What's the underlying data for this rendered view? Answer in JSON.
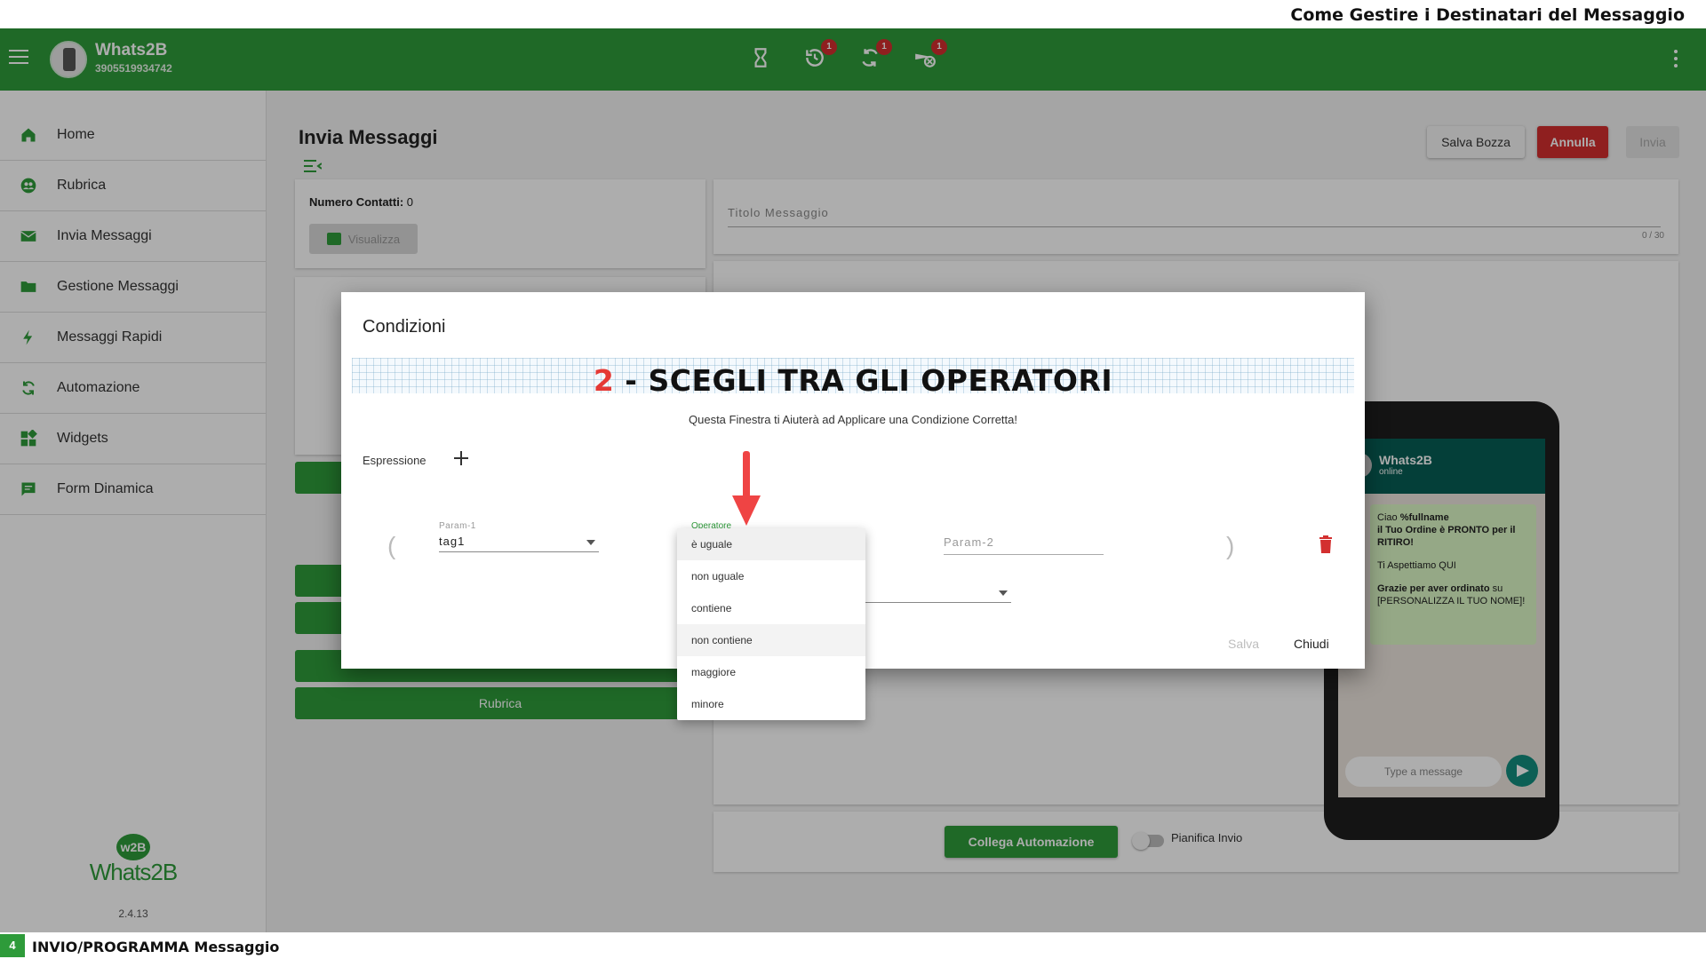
{
  "video": {
    "title": "Come Gestire i Destinatari del Messaggio"
  },
  "app": {
    "name": "Whats2B",
    "phone": "3905519934742"
  },
  "header_icons": [
    {
      "icon": "hourglass-icon",
      "badge": ""
    },
    {
      "icon": "history-icon",
      "badge": "1"
    },
    {
      "icon": "sync-icon",
      "badge": "1"
    },
    {
      "icon": "scheduled-off-icon",
      "badge": "1"
    }
  ],
  "sidebar": {
    "items": [
      {
        "label": "Home",
        "icon": "home-icon"
      },
      {
        "label": "Rubrica",
        "icon": "contacts-icon"
      },
      {
        "label": "Invia Messaggi",
        "icon": "mail-icon"
      },
      {
        "label": "Gestione Messaggi",
        "icon": "folder-icon"
      },
      {
        "label": "Messaggi Rapidi",
        "icon": "bolt-icon"
      },
      {
        "label": "Automazione",
        "icon": "refresh-icon"
      },
      {
        "label": "Widgets",
        "icon": "widgets-icon"
      },
      {
        "label": "Form Dinamica",
        "icon": "form-icon"
      }
    ],
    "logo_text": "Whats2B",
    "logo_badge": "w2B",
    "version": "2.4.13"
  },
  "main": {
    "page_title": "Invia Messaggi",
    "btn_draft": "Salva Bozza",
    "btn_cancel": "Annulla",
    "btn_send": "Invia",
    "contacts_label": "Numero Contatti:",
    "contacts_count": "0",
    "btn_view": "Visualizza",
    "title_placeholder": "Titolo Messaggio",
    "title_counter": "0 / 30",
    "btn_rubrica": "Rubrica",
    "btn_automation": "Collega Automazione",
    "schedule_label": "Pianifica Invio"
  },
  "preview": {
    "contact_name": "Whats2B",
    "contact_status": "online",
    "line1_prefix": "Ciao ",
    "line1_var": "%fullname",
    "line2": "il Tuo Ordine è PRONTO per il RITIRO!",
    "line3": "Ti Aspettiamo QUI",
    "line4_bold": "Grazie per aver ordinato",
    "line4_rest": " su [PERSONALIZZA IL TUO NOME]!",
    "input_placeholder": "Type a message"
  },
  "modal": {
    "title": "Condizioni",
    "annotation_number": "2",
    "annotation_text": " - SCEGLI TRA GLI OPERATORI",
    "subtitle": "Questa Finestra ti Aiuterà ad Applicare una Condizione Corretta!",
    "expression_label": "Espressione",
    "param1_label": "Param-1",
    "param1_value": "tag1",
    "operator_label": "Operatore",
    "param2_placeholder": "Param-2",
    "paren_open": "(",
    "paren_close": ")",
    "btn_save": "Salva",
    "btn_close": "Chiudi"
  },
  "dropdown": {
    "options": [
      "è uguale",
      "non uguale",
      "contiene",
      "non contiene",
      "maggiore",
      "minore"
    ],
    "selected": "è uguale",
    "hovered": "non contiene"
  },
  "bottom": {
    "step": "4",
    "label": "INVIO/PROGRAMMA Messaggio"
  },
  "colors": {
    "brand_green": "#2e9b3a",
    "danger_red": "#d32f2f",
    "annotation_red": "#e53935",
    "arrow_red": "#ef4444"
  }
}
